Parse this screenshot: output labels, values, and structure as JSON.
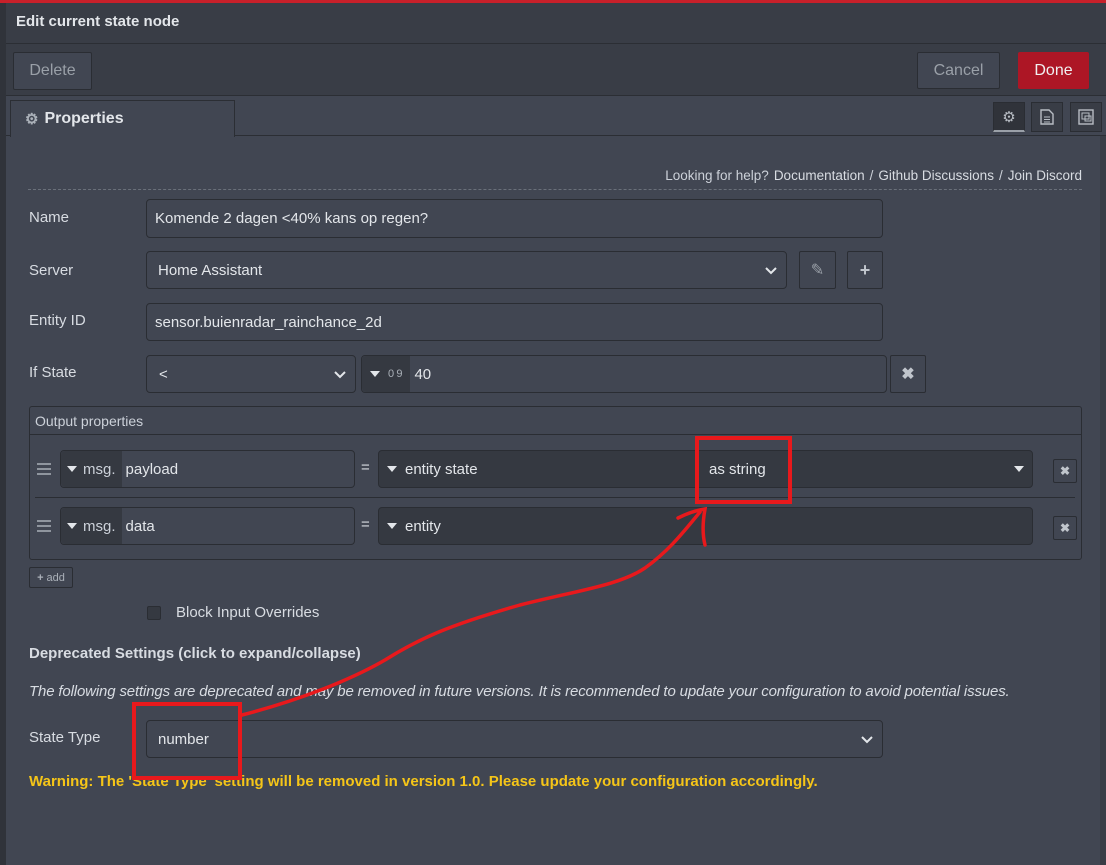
{
  "header": {
    "title": "Edit current state node"
  },
  "tray": {
    "delete": "Delete",
    "cancel": "Cancel",
    "done": "Done"
  },
  "tabs": {
    "properties": "Properties"
  },
  "help": {
    "prompt": "Looking for help?",
    "links": [
      "Documentation",
      "Github Discussions",
      "Join Discord"
    ],
    "separator": "/"
  },
  "form": {
    "name": {
      "label": "Name",
      "value": "Komende 2 dagen <40% kans op regen?"
    },
    "server": {
      "label": "Server",
      "value": "Home Assistant"
    },
    "entity": {
      "label": "Entity ID",
      "value": "sensor.buienradar_rainchance_2d"
    },
    "if_state": {
      "label": "If State",
      "operator": "<",
      "type_icon": "0 9",
      "value": "40"
    }
  },
  "output": {
    "title": "Output properties",
    "rows": [
      {
        "prefix": "msg.",
        "property": "payload",
        "eq": "=",
        "source": "entity state",
        "format": "as string"
      },
      {
        "prefix": "msg.",
        "property": "data",
        "eq": "=",
        "source": "entity",
        "format": ""
      }
    ],
    "add": "add"
  },
  "block_input": {
    "label": "Block Input Overrides",
    "checked": false
  },
  "deprecated": {
    "title": "Deprecated Settings (click to expand/collapse)",
    "description": "The following settings are deprecated and may be removed in future versions. It is recommended to update your configuration to avoid potential issues.",
    "state_type": {
      "label": "State Type",
      "value": "number"
    },
    "warning": "Warning: The 'State Type' setting will be removed in version 1.0. Please update your configuration accordingly."
  },
  "colors": {
    "accent": "#ad1625",
    "warning": "#f5c518",
    "annotation": "#e8191c"
  }
}
